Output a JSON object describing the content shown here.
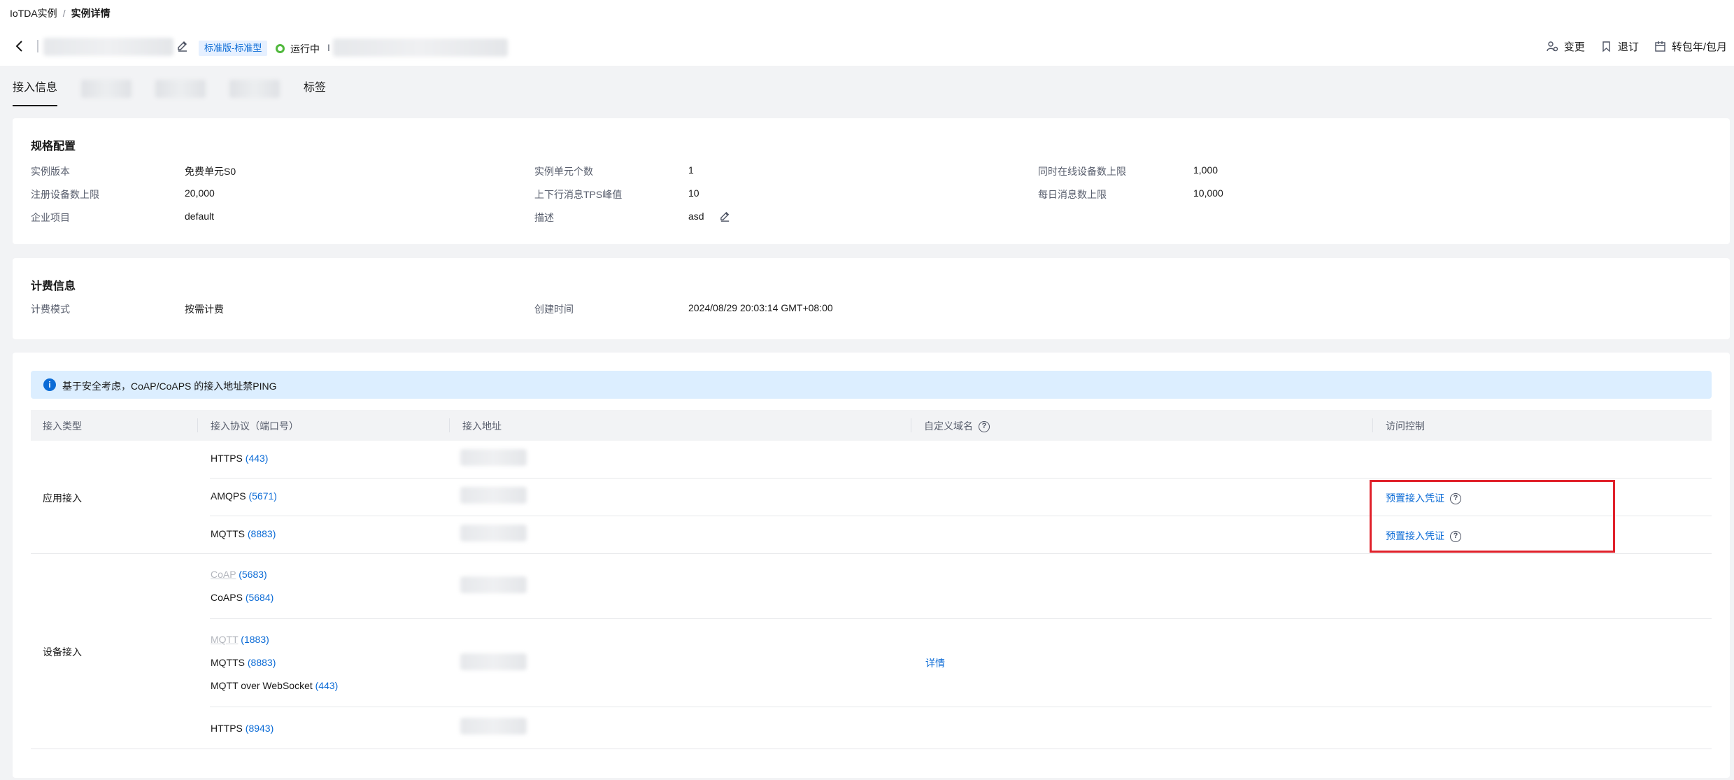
{
  "breadcrumb": {
    "parent": "IoTDA实例",
    "separator": "/",
    "current": "实例详情"
  },
  "header": {
    "edition_tag": "标准版-标准型",
    "status": "运行中",
    "id_prefix": "I"
  },
  "actions": [
    {
      "label": "变更",
      "icon": "change-icon"
    },
    {
      "label": "退订",
      "icon": "bookmark-icon"
    },
    {
      "label": "转包年/包月",
      "icon": "calendar-icon"
    }
  ],
  "tabs": {
    "first": "接入信息",
    "last": "标签"
  },
  "spec": {
    "title": "规格配置",
    "items": [
      {
        "label": "实例版本",
        "value": "免费单元S0"
      },
      {
        "label": "实例单元个数",
        "value": "1"
      },
      {
        "label": "同时在线设备数上限",
        "value": "1,000"
      },
      {
        "label": "注册设备数上限",
        "value": "20,000"
      },
      {
        "label": "上下行消息TPS峰值",
        "value": "10"
      },
      {
        "label": "每日消息数上限",
        "value": "10,000"
      },
      {
        "label": "企业项目",
        "value": "default"
      },
      {
        "label": "描述",
        "value": "asd"
      }
    ]
  },
  "billing": {
    "title": "计费信息",
    "mode_label": "计费模式",
    "mode_value": "按需计费",
    "created_label": "创建时间",
    "created_value": "2024/08/29 20:03:14 GMT+08:00"
  },
  "access": {
    "notice": "基于安全考虑，CoAP/CoAPS 的接入地址禁PING",
    "columns": [
      "接入类型",
      "接入协议（端口号）",
      "接入地址",
      "自定义域名",
      "访问控制"
    ],
    "app_type": "应用接入",
    "device_type": "设备接入",
    "protocols": {
      "https443": {
        "name": "HTTPS",
        "port": "(443)"
      },
      "amqps": {
        "name": "AMQPS",
        "port": "(5671)"
      },
      "mqtts_app": {
        "name": "MQTTS",
        "port": "(8883)"
      },
      "coap": {
        "name": "CoAP",
        "port": "(5683)"
      },
      "coaps": {
        "name": "CoAPS",
        "port": "(5684)"
      },
      "mqtt": {
        "name": "MQTT",
        "port": "(1883)"
      },
      "mqtts_dev": {
        "name": "MQTTS",
        "port": "(8883)"
      },
      "mqtt_ws": {
        "name": "MQTT over WebSocket",
        "port": "(443)"
      },
      "https8943": {
        "name": "HTTPS",
        "port": "(8943)"
      }
    },
    "preset_credential": "预置接入凭证",
    "details_link": "详情"
  }
}
